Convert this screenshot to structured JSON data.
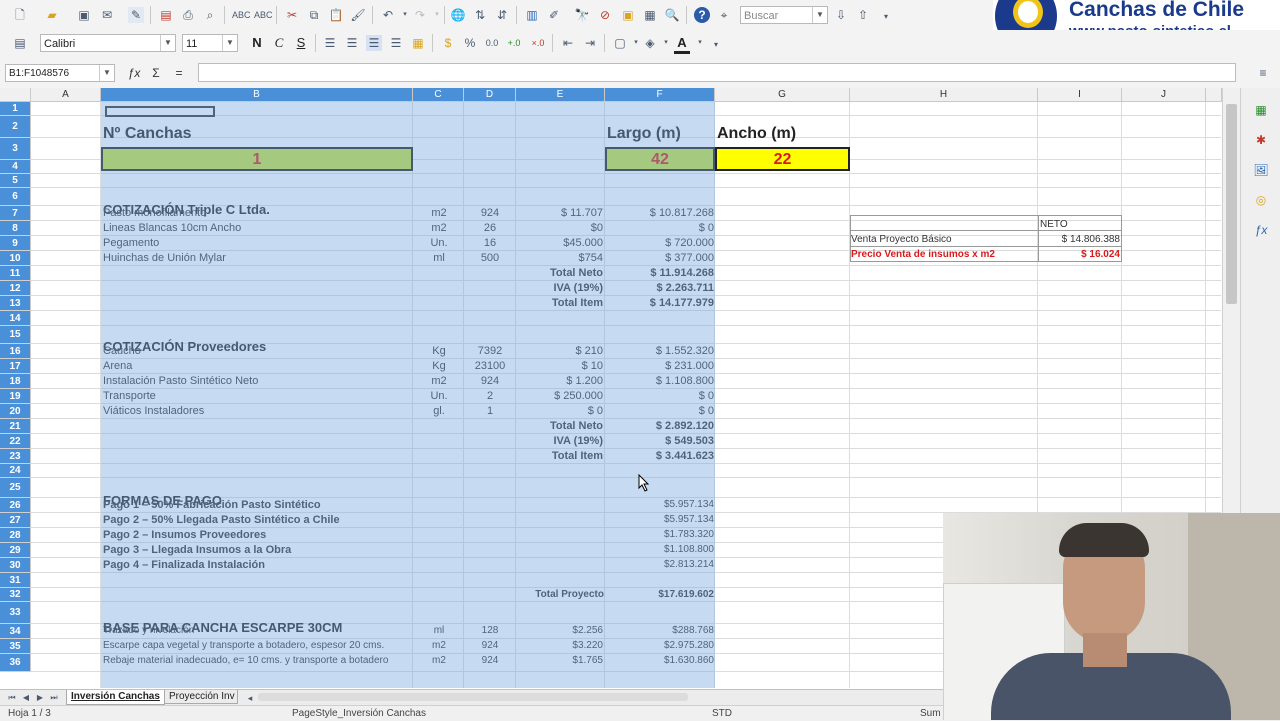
{
  "toolbar": {
    "search_placeholder": "Buscar",
    "font_name": "Calibri",
    "font_size": "11",
    "bold_label": "N",
    "italic_label": "C",
    "underline_label": "S"
  },
  "formula_bar": {
    "name_box": "B1:F1048576",
    "fx": "ƒx",
    "sum": "Σ",
    "equals": "="
  },
  "logo": {
    "name": "Canchas de Chile",
    "url": "www.pasto-sintetico.cl"
  },
  "columns": [
    "A",
    "B",
    "C",
    "D",
    "E",
    "F",
    "G",
    "H",
    "I",
    "J"
  ],
  "rows": [
    "1",
    "2",
    "3",
    "4",
    "5",
    "6",
    "7",
    "8",
    "9",
    "10",
    "11",
    "12",
    "13",
    "14",
    "15",
    "16",
    "17",
    "18",
    "19",
    "20",
    "21",
    "22",
    "23",
    "24",
    "25",
    "26",
    "27",
    "28",
    "29",
    "30",
    "31",
    "32",
    "33",
    "34",
    "35",
    "36"
  ],
  "header_block": {
    "n_canchas_label": "Nº Canchas",
    "n_canchas_value": "1",
    "largo_label": "Largo (m)",
    "largo_value": "42",
    "ancho_label": "Ancho (m)",
    "ancho_value": "22"
  },
  "cotizacion_triple": {
    "title": "COTIZACIÓN Triple C Ltda.",
    "items": [
      {
        "desc": "Pasto monofilamento",
        "unit": "m2",
        "qty": "924",
        "price": "$ 11.707",
        "total": "$ 10.817.268"
      },
      {
        "desc": "Lineas Blancas 10cm Ancho",
        "unit": "m2",
        "qty": "26",
        "price": "$0",
        "total": "$ 0"
      },
      {
        "desc": "Pegamento",
        "unit": "Un.",
        "qty": "16",
        "price": "$45.000",
        "total": "$ 720.000"
      },
      {
        "desc": "Huinchas de Unión Mylar",
        "unit": "ml",
        "qty": "500",
        "price": "$754",
        "total": "$ 377.000"
      }
    ],
    "totals": [
      {
        "label": "Total Neto",
        "value": "$ 11.914.268"
      },
      {
        "label": "IVA (19%)",
        "value": "$ 2.263.711"
      },
      {
        "label": "Total Item",
        "value": "$ 14.177.979"
      }
    ]
  },
  "cotizacion_proveedores": {
    "title": "COTIZACIÓN Proveedores",
    "items": [
      {
        "desc": "Caucho",
        "unit": "Kg",
        "qty": "7392",
        "price": "$ 210",
        "total": "$ 1.552.320"
      },
      {
        "desc": "Arena",
        "unit": "Kg",
        "qty": "23100",
        "price": "$ 10",
        "total": "$ 231.000"
      },
      {
        "desc": "Instalación Pasto Sintético Neto",
        "unit": "m2",
        "qty": "924",
        "price": "$ 1.200",
        "total": "$ 1.108.800"
      },
      {
        "desc": "Transporte",
        "unit": "Un.",
        "qty": "2",
        "price": "$ 250.000",
        "total": "$ 0"
      },
      {
        "desc": "Viáticos Instaladores",
        "unit": "gl.",
        "qty": "1",
        "price": "$ 0",
        "total": "$ 0"
      }
    ],
    "totals": [
      {
        "label": "Total Neto",
        "value": "$ 2.892.120"
      },
      {
        "label": "IVA (19%)",
        "value": "$ 549.503"
      },
      {
        "label": "Total Item",
        "value": "$ 3.441.623"
      }
    ]
  },
  "formas_pago": {
    "title": "FORMAS DE PAGO",
    "items": [
      {
        "desc": "Pago 1 – 50% Fabricación Pasto Sintético",
        "value": "$5.957.134"
      },
      {
        "desc": "Pago 2 – 50% Llegada Pasto Sintético a Chile",
        "value": "$5.957.134"
      },
      {
        "desc": "Pago 2 – Insumos Proveedores",
        "value": "$1.783.320"
      },
      {
        "desc": "Pago 3 – Llegada Insumos a la Obra",
        "value": "$1.108.800"
      },
      {
        "desc": "Pago 4 – Finalizada Instalación",
        "value": "$2.813.214"
      }
    ],
    "total_label": "Total Proyecto",
    "total_value": "$17.619.602"
  },
  "base_cancha": {
    "title": "BASE PARA CANCHA ESCARPE 30CM",
    "items": [
      {
        "desc": "Trazado y nivelación",
        "unit": "ml",
        "qty": "128",
        "price": "$2.256",
        "total": "$288.768"
      },
      {
        "desc": "Escarpe capa vegetal y transporte a botadero, espesor 20 cms.",
        "unit": "m2",
        "qty": "924",
        "price": "$3.220",
        "total": "$2.975.280"
      },
      {
        "desc": "Rebaje material inadecuado, e= 10 cms. y transporte a botadero",
        "unit": "m2",
        "qty": "924",
        "price": "$1.765",
        "total": "$1.630.860"
      }
    ]
  },
  "side_box": {
    "neto_label": "NETO",
    "venta_label": "Venta Proyecto Básico",
    "venta_value": "$ 14.806.388",
    "precio_label": "Precio Venta de insumos x m2",
    "precio_value": "$ 16.024"
  },
  "sheet_tabs": [
    "Inversión Canchas",
    "Proyección Inv"
  ],
  "status": {
    "sheet": "Hoja 1 / 3",
    "pagestyle": "PageStyle_Inversión Canchas",
    "mode": "STD",
    "sum": "Sum"
  },
  "colors": {
    "selection": "#4a90d9",
    "green_cell": "#c5e13a",
    "yellow_cell": "#ffff00",
    "red_text": "#d91a1a",
    "logo_blue": "#1b3a8c"
  }
}
